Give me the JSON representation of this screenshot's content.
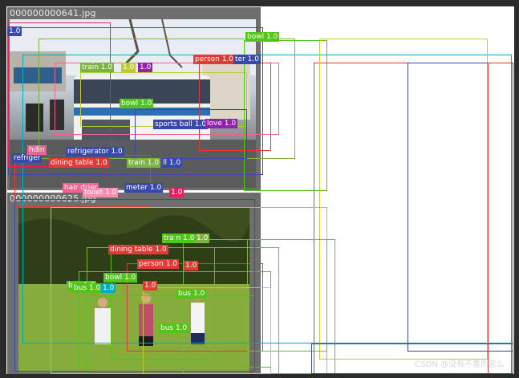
{
  "images": [
    {
      "filename": "000000000641.jpg"
    },
    {
      "filename": "000000000625.jpg"
    }
  ],
  "colors": {
    "frame": "#2b2b2b",
    "canvas": "#ffffff",
    "tile": "#6e6e6e"
  },
  "detections": [
    {
      "label": "bowl 1.0",
      "color": "#52c41a"
    },
    {
      "label": "person 1.0",
      "color": "#e53935"
    },
    {
      "label": "ter 1.0",
      "color": "#3949ab"
    },
    {
      "label": "train 1.0",
      "color": "#7cb342"
    },
    {
      "label": "1.0",
      "color": "#c0ca33"
    },
    {
      "label": "1.0",
      "color": "#8e24aa"
    },
    {
      "label": "bowl 1.0",
      "color": "#52c41a"
    },
    {
      "label": "sports ball 1.0",
      "color": "#3949ab"
    },
    {
      "label": "love 1.0",
      "color": "#8e24aa"
    },
    {
      "label": "refrigerator 1.0",
      "color": "#3949ab"
    },
    {
      "label": "dining table 1.0",
      "color": "#e53935"
    },
    {
      "label": "train 1.0",
      "color": "#7cb342"
    },
    {
      "label": "ll 1.0",
      "color": "#3949ab"
    },
    {
      "label": "meter 1.0",
      "color": "#3949ab"
    },
    {
      "label": "1.0",
      "color": "#e91e63"
    },
    {
      "label": "hair drier",
      "color": "#f06292"
    },
    {
      "label": "toilet 1.0",
      "color": "#f48fb1"
    },
    {
      "label": "dining table 1.0",
      "color": "#e53935"
    },
    {
      "label": "person 1.0",
      "color": "#e53935"
    },
    {
      "label": "1.0",
      "color": "#e53935"
    },
    {
      "label": "bus 1.0",
      "color": "#52c41a"
    },
    {
      "label": "bowl 1.0",
      "color": "#52c41a"
    },
    {
      "label": "bus 1.0",
      "color": "#52c41a"
    },
    {
      "label": "1.0",
      "color": "#00acc1"
    },
    {
      "label": "1.0",
      "color": "#e53935"
    },
    {
      "label": "bus 1.0",
      "color": "#52c41a"
    },
    {
      "label": "bus 1.0",
      "color": "#52c41a"
    },
    {
      "label": "1.0",
      "color": "#7cb342"
    },
    {
      "label": "tra n 1.0",
      "color": "#52c41a"
    },
    {
      "label": "refriger",
      "color": "#3949ab"
    },
    {
      "label": "hdin",
      "color": "#f06292"
    },
    {
      "label": "1.0",
      "color": "#3949ab"
    }
  ],
  "watermark": "CSDN @没有不重的名么"
}
